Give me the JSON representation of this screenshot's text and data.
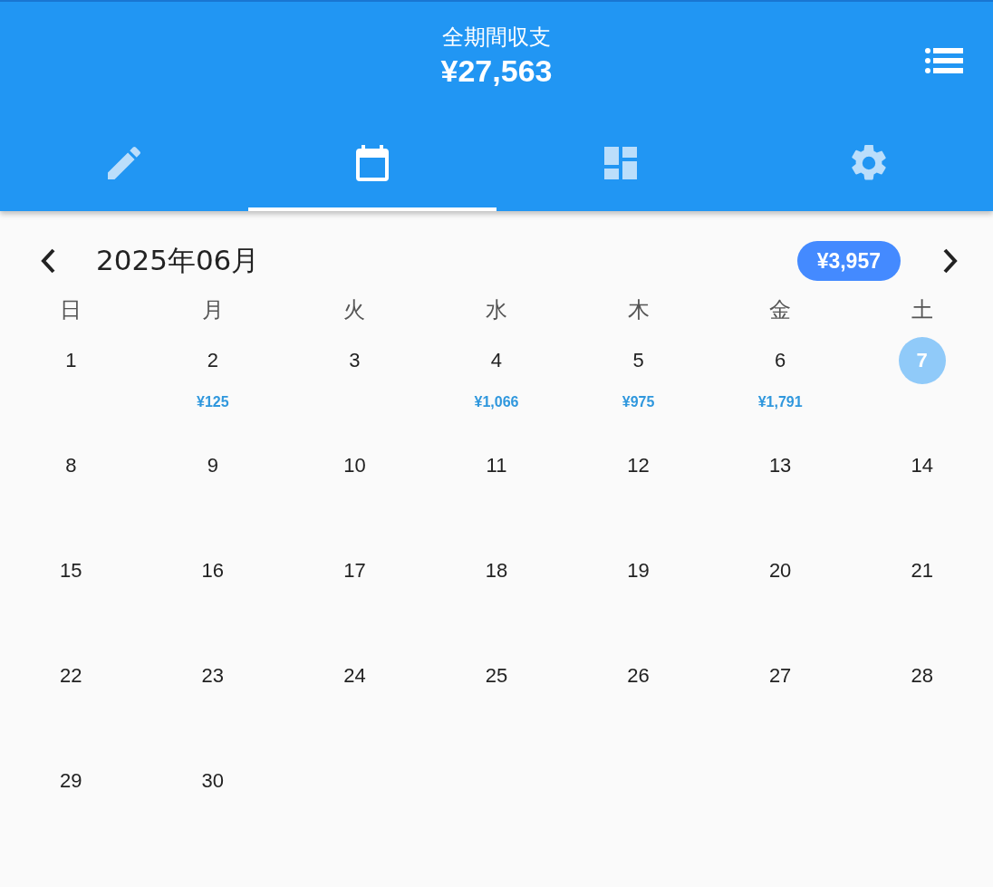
{
  "header": {
    "title": "全期間収支",
    "total": "¥27,563"
  },
  "tabs": [
    {
      "kind": "edit",
      "selected": false
    },
    {
      "kind": "calendar",
      "selected": true
    },
    {
      "kind": "dashboard",
      "selected": false
    },
    {
      "kind": "settings",
      "selected": false
    }
  ],
  "month": {
    "label": "2025年06月",
    "balance": "¥3,957"
  },
  "weekdays": [
    "日",
    "月",
    "火",
    "水",
    "木",
    "金",
    "土"
  ],
  "weeks": [
    [
      {
        "day": "1",
        "selected": false
      },
      {
        "day": "2",
        "amount": "¥125",
        "selected": false
      },
      {
        "day": "3",
        "selected": false
      },
      {
        "day": "4",
        "amount": "¥1,066",
        "selected": false
      },
      {
        "day": "5",
        "amount": "¥975",
        "selected": false
      },
      {
        "day": "6",
        "amount": "¥1,791",
        "selected": false
      },
      {
        "day": "7",
        "selected": true
      }
    ],
    [
      {
        "day": "8",
        "selected": false
      },
      {
        "day": "9",
        "selected": false
      },
      {
        "day": "10",
        "selected": false
      },
      {
        "day": "11",
        "selected": false
      },
      {
        "day": "12",
        "selected": false
      },
      {
        "day": "13",
        "selected": false
      },
      {
        "day": "14",
        "selected": false
      }
    ],
    [
      {
        "day": "15",
        "selected": false
      },
      {
        "day": "16",
        "selected": false
      },
      {
        "day": "17",
        "selected": false
      },
      {
        "day": "18",
        "selected": false
      },
      {
        "day": "19",
        "selected": false
      },
      {
        "day": "20",
        "selected": false
      },
      {
        "day": "21",
        "selected": false
      }
    ],
    [
      {
        "day": "22",
        "selected": false
      },
      {
        "day": "23",
        "selected": false
      },
      {
        "day": "24",
        "selected": false
      },
      {
        "day": "25",
        "selected": false
      },
      {
        "day": "26",
        "selected": false
      },
      {
        "day": "27",
        "selected": false
      },
      {
        "day": "28",
        "selected": false
      }
    ],
    [
      {
        "day": "29",
        "selected": false
      },
      {
        "day": "30",
        "selected": false
      }
    ]
  ]
}
